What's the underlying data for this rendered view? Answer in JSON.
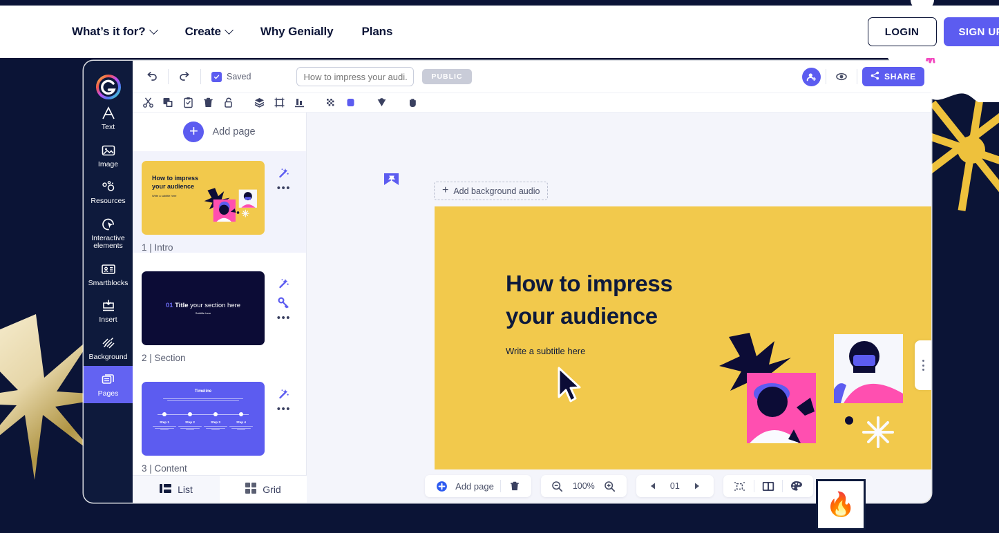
{
  "navbar": {
    "links": [
      {
        "label": "What’s it for?",
        "has_caret": true
      },
      {
        "label": "Create",
        "has_caret": true
      },
      {
        "label": "Why Genially",
        "has_caret": false
      },
      {
        "label": "Plans",
        "has_caret": false
      }
    ],
    "login_label": "LOGIN",
    "signup_label": "SIGN UP"
  },
  "editor": {
    "rail": {
      "logo_icon": "genially-logo-icon",
      "items": [
        {
          "label": "Text",
          "icon": "text-icon",
          "active": false
        },
        {
          "label": "Image",
          "icon": "image-icon",
          "active": false
        },
        {
          "label": "Resources",
          "icon": "resources-icon",
          "active": false
        },
        {
          "label": "Interactive elements",
          "icon": "interactive-elements-icon",
          "active": false
        },
        {
          "label": "Smartblocks",
          "icon": "smartblocks-icon",
          "active": false
        },
        {
          "label": "Insert",
          "icon": "insert-icon",
          "active": false
        },
        {
          "label": "Background",
          "icon": "background-icon",
          "active": false
        },
        {
          "label": "Pages",
          "icon": "pages-icon",
          "active": true
        }
      ]
    },
    "topbar": {
      "undo_icon": "undo-icon",
      "redo_icon": "redo-icon",
      "saved_label": "Saved",
      "title_value": "",
      "title_placeholder": "How to impress your audi...",
      "public_label": "PUBLIC",
      "invite_icon": "add-user-icon",
      "preview_icon": "eye-icon",
      "share_label": "SHARE",
      "share_icon": "share-icon"
    },
    "toolbar": {
      "tools": [
        {
          "name": "cut-icon"
        },
        {
          "name": "duplicate-icon"
        },
        {
          "name": "paste-icon"
        },
        {
          "name": "delete-icon"
        },
        {
          "name": "unlock-icon"
        },
        {
          "name": "layers-icon"
        },
        {
          "name": "crop-icon"
        },
        {
          "name": "align-icon"
        },
        {
          "name": "transparency-icon"
        },
        {
          "name": "fill-color-icon"
        },
        {
          "name": "shape-icon"
        },
        {
          "name": "hand-icon"
        }
      ],
      "fill_color": "#5C5CF0"
    },
    "pages_panel": {
      "add_page_label": "Add page",
      "pages": [
        {
          "name": "1 | Intro",
          "selected": true,
          "thumb": {
            "type": "intro",
            "bg": "#F2C94C",
            "title": "How to impress\nyour audience",
            "subtitle": "Write a subtitle here"
          },
          "tools": [
            "magic-wand-icon",
            "more-options-icon"
          ]
        },
        {
          "name": "2 | Section",
          "selected": false,
          "thumb": {
            "type": "section",
            "bg": "#0C0C36",
            "number": "01",
            "title_bold": "Title",
            "title_rest": " your section here",
            "subtitle": "Subtitle here"
          },
          "tools": [
            "magic-wand-icon",
            "key-icon",
            "more-options-icon"
          ]
        },
        {
          "name": "3 | Content",
          "selected": false,
          "thumb": {
            "type": "timeline",
            "bg": "#5C5CF0",
            "title": "Timeline",
            "steps": [
              "Step 1",
              "Step 2",
              "Step 3",
              "Step 4"
            ]
          },
          "tools": [
            "magic-wand-icon",
            "more-options-icon"
          ]
        }
      ],
      "view_modes": [
        {
          "label": "List",
          "icon": "list-view-icon",
          "active": true
        },
        {
          "label": "Grid",
          "icon": "grid-view-icon",
          "active": false
        }
      ]
    },
    "canvas": {
      "pin_icon": "pin-icon",
      "add_audio_label": "Add background audio",
      "slide": {
        "bg": "#F2C94C",
        "title_line1": "How to impress",
        "title_line2": "your audience",
        "subtitle": "Write a subtitle here"
      },
      "right_handle_icon": "panel-handle-icon"
    },
    "bottombar": {
      "add_page_label": "Add page",
      "add_page_icon": "add-circle-icon",
      "delete_icon": "trash-icon",
      "zoom_out_icon": "zoom-out-icon",
      "zoom_value": "100%",
      "zoom_in_icon": "zoom-in-icon",
      "prev_icon": "prev-page-icon",
      "page_value": "01",
      "next_icon": "next-page-icon",
      "grid_icon": "guides-icon",
      "pages_view_icon": "two-pages-icon",
      "theme_icon": "palette-icon"
    }
  },
  "overlay": {
    "fire_emoji": "🔥"
  },
  "colors": {
    "brand_purple": "#5C5CF0",
    "dark_navy": "#0B1436",
    "slide_yellow": "#F2C94C",
    "decor_gold": "#EEC13C",
    "pink": "#FF4FB0"
  }
}
